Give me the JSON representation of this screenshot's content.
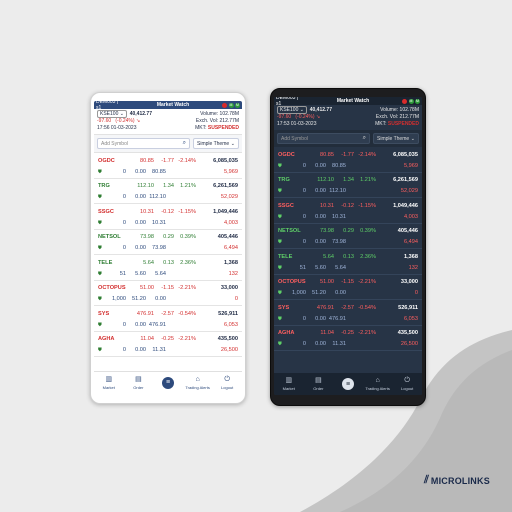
{
  "colors": {
    "up": "#2e7d32",
    "down": "#d32f2f",
    "brand": "#2d4a7c"
  },
  "titlebar": {
    "account": "DEM003 | s1",
    "title": "Market Watch",
    "dot1": "",
    "dot2": "M",
    "dot3": "M"
  },
  "index": {
    "name": "KSE100",
    "value": "40,412.77",
    "volume": "Volume: 102.78M",
    "change": "-97.60",
    "change_pct": "(-0.24%)",
    "exch_vol": "Exch. Vol: 212.77M",
    "datetime_light": "17:56 01-03-2023",
    "datetime_dark": "17:53 01-03-2023",
    "mkt_label": "MKT:",
    "mkt_status": "SUSPENDED"
  },
  "search": {
    "placeholder": "Add Symbol",
    "theme": "Simple Theme"
  },
  "rows": [
    {
      "symbol": "OGDC",
      "dir": "down",
      "ltp": "80.85",
      "chg": "-1.77",
      "pct": "-2.14%",
      "vol": "6,085,035",
      "bq": "0",
      "bp": "0.00",
      "ap": "80.85",
      "aq": "5,969"
    },
    {
      "symbol": "TRG",
      "dir": "up",
      "ltp": "112.10",
      "chg": "1.34",
      "pct": "1.21%",
      "vol": "6,261,569",
      "bq": "0",
      "bp": "0.00",
      "ap": "112.10",
      "aq": "52,029"
    },
    {
      "symbol": "SSGC",
      "dir": "down",
      "ltp": "10.31",
      "chg": "-0.12",
      "pct": "-1.15%",
      "vol": "1,049,446",
      "bq": "0",
      "bp": "0.00",
      "ap": "10.31",
      "aq": "4,003"
    },
    {
      "symbol": "NETSOL",
      "dir": "up",
      "ltp": "73.98",
      "chg": "0.29",
      "pct": "0.39%",
      "vol": "405,446",
      "bq": "0",
      "bp": "0.00",
      "ap": "73.98",
      "aq": "6,494"
    },
    {
      "symbol": "TELE",
      "dir": "up",
      "ltp": "5.64",
      "chg": "0.13",
      "pct": "2.36%",
      "vol": "1,368",
      "bq": "51",
      "bp": "5.60",
      "ap": "5.64",
      "aq": "132"
    },
    {
      "symbol": "OCTOPUS",
      "dir": "down",
      "ltp": "51.00",
      "chg": "-1.15",
      "pct": "-2.21%",
      "vol": "33,000",
      "bq": "1,000",
      "bp": "51.20",
      "ap": "0.00",
      "aq": "0"
    },
    {
      "symbol": "SYS",
      "dir": "down",
      "ltp": "476.91",
      "chg": "-2.57",
      "pct": "-0.54%",
      "vol": "526,911",
      "bq": "0",
      "bp": "0.00",
      "ap": "476.91",
      "aq": "6,053"
    },
    {
      "symbol": "AGHA",
      "dir": "down",
      "ltp": "11.04",
      "chg": "-0.25",
      "pct": "-2.21%",
      "vol": "435,500",
      "bq": "0",
      "bp": "0.00",
      "ap": "11.31",
      "aq": "26,500"
    }
  ],
  "tabs": [
    {
      "label": "Market",
      "icon": "market-icon"
    },
    {
      "label": "Order",
      "icon": "order-icon"
    },
    {
      "label": "",
      "icon": "menu-icon"
    },
    {
      "label": "Trading Alerts",
      "icon": "alerts-icon"
    },
    {
      "label": "Logout",
      "icon": "power-icon"
    }
  ],
  "brand": {
    "name": "MICROLINKS"
  }
}
